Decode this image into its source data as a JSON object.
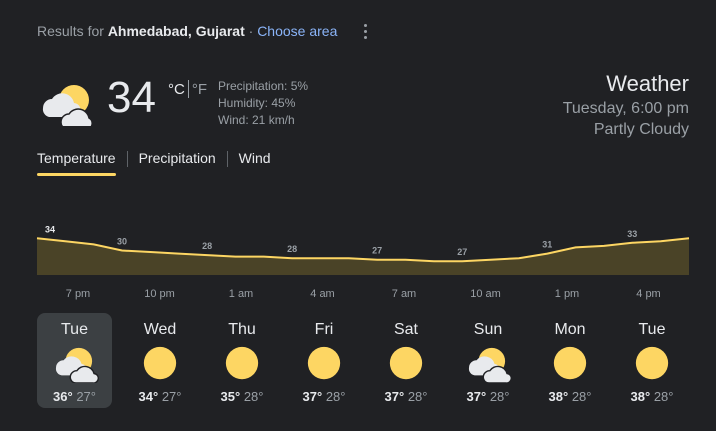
{
  "header": {
    "results_prefix": "Results for",
    "location": "Ahmedabad, Gujarat",
    "separator": "·",
    "choose_area": "Choose area"
  },
  "current": {
    "icon": "partly-cloudy-icon",
    "temperature": "34",
    "unit_c": "°C",
    "unit_f": "°F",
    "precipitation": "Precipitation: 5%",
    "humidity": "Humidity: 45%",
    "wind": "Wind: 21 km/h"
  },
  "summary": {
    "title": "Weather",
    "datetime": "Tuesday, 6:00 pm",
    "condition": "Partly Cloudy"
  },
  "tabs": [
    "Temperature",
    "Precipitation",
    "Wind"
  ],
  "active_tab": 0,
  "colors": {
    "background": "#202124",
    "accent_line": "#fdd663",
    "chart_fill": "#4a4327",
    "link": "#8ab4f8",
    "sun": "#fdd663"
  },
  "chart_data": {
    "type": "area",
    "x": [
      "6 pm",
      "7 pm",
      "8 pm",
      "9 pm",
      "10 pm",
      "11 pm",
      "12 am",
      "1 am",
      "2 am",
      "3 am",
      "4 am",
      "5 am",
      "6 am",
      "7 am",
      "8 am",
      "9 am",
      "10 am",
      "11 am",
      "12 pm",
      "1 pm",
      "2 pm",
      "3 pm",
      "4 pm",
      "5 pm"
    ],
    "values": [
      34,
      33,
      32,
      30,
      29.5,
      29,
      28.5,
      28,
      28,
      27.5,
      27.5,
      27.5,
      27,
      27,
      26.5,
      26.5,
      27,
      27.5,
      29,
      31,
      31.5,
      32.5,
      33,
      34
    ],
    "labels": [
      {
        "index": 0,
        "text": "34"
      },
      {
        "index": 3,
        "text": "30"
      },
      {
        "index": 6,
        "text": "28"
      },
      {
        "index": 9,
        "text": "28"
      },
      {
        "index": 12,
        "text": "27"
      },
      {
        "index": 15,
        "text": "27"
      },
      {
        "index": 18,
        "text": "31"
      },
      {
        "index": 21,
        "text": "33"
      }
    ],
    "tick_labels": [
      "7 pm",
      "10 pm",
      "1 am",
      "4 am",
      "7 am",
      "10 am",
      "1 pm",
      "4 pm"
    ],
    "tick_indices": [
      1,
      4,
      7,
      10,
      13,
      16,
      19,
      22
    ],
    "unit": "°C"
  },
  "forecast": [
    {
      "day": "Tue",
      "icon": "partly-cloudy-icon",
      "high": "36°",
      "low": "27°"
    },
    {
      "day": "Wed",
      "icon": "sunny-icon",
      "high": "34°",
      "low": "27°"
    },
    {
      "day": "Thu",
      "icon": "sunny-icon",
      "high": "35°",
      "low": "28°"
    },
    {
      "day": "Fri",
      "icon": "sunny-icon",
      "high": "37°",
      "low": "28°"
    },
    {
      "day": "Sat",
      "icon": "sunny-icon",
      "high": "37°",
      "low": "28°"
    },
    {
      "day": "Sun",
      "icon": "partly-cloudy-icon",
      "high": "37°",
      "low": "28°"
    },
    {
      "day": "Mon",
      "icon": "sunny-icon",
      "high": "38°",
      "low": "28°"
    },
    {
      "day": "Tue",
      "icon": "sunny-icon",
      "high": "38°",
      "low": "28°"
    }
  ]
}
